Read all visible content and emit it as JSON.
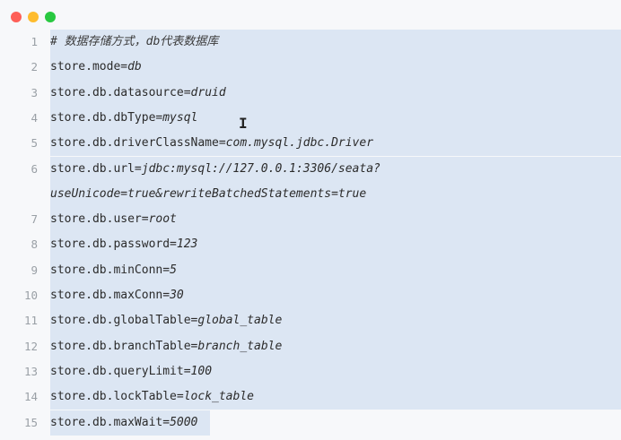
{
  "window": {
    "traffic_lights": [
      "close",
      "minimize",
      "zoom"
    ]
  },
  "colors": {
    "selection": "#dce6f3",
    "background": "#f7f8fa",
    "gutter_text": "#9aa0a6"
  },
  "lines": [
    {
      "num": "1",
      "key": "# 数据存储方式，db代表数据库",
      "value": ""
    },
    {
      "num": "2",
      "key": "store.mode=",
      "value": "db"
    },
    {
      "num": "3",
      "key": "store.db.datasource=",
      "value": "druid"
    },
    {
      "num": "4",
      "key": "store.db.dbType=",
      "value": "mysql"
    },
    {
      "num": "5",
      "key": "store.db.driverClassName=",
      "value": "com.mysql.jdbc.Driver"
    },
    {
      "num": "6",
      "key": "store.db.url=",
      "value": "jdbc:mysql://127.0.0.1:3306/seata?"
    },
    {
      "num": "",
      "key": "",
      "value": "useUnicode=true&rewriteBatchedStatements=true"
    },
    {
      "num": "7",
      "key": "store.db.user=",
      "value": "root"
    },
    {
      "num": "8",
      "key": "store.db.password=",
      "value": "123"
    },
    {
      "num": "9",
      "key": "store.db.minConn=",
      "value": "5"
    },
    {
      "num": "10",
      "key": "store.db.maxConn=",
      "value": "30"
    },
    {
      "num": "11",
      "key": "store.db.globalTable=",
      "value": "global_table"
    },
    {
      "num": "12",
      "key": "store.db.branchTable=",
      "value": "branch_table"
    },
    {
      "num": "13",
      "key": "store.db.queryLimit=",
      "value": "100"
    },
    {
      "num": "14",
      "key": "store.db.lockTable=",
      "value": "lock_table"
    },
    {
      "num": "15",
      "key": "store.db.maxWait=",
      "value": "5000"
    }
  ],
  "cursor": {
    "glyph": "I"
  }
}
